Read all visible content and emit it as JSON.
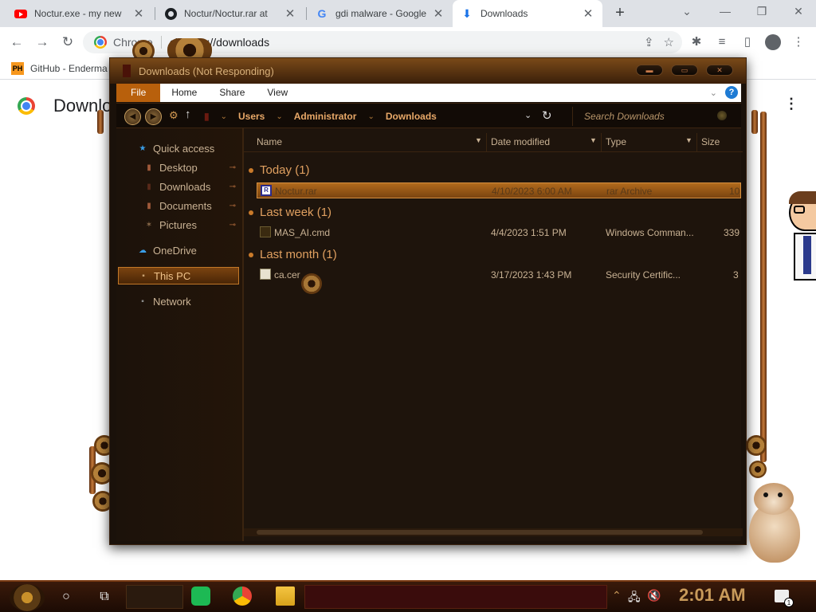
{
  "browser": {
    "tabs": [
      {
        "title": "Noctur.exe - my new",
        "icon": "youtube-icon"
      },
      {
        "title": "Noctur/Noctur.rar at",
        "icon": "github-icon"
      },
      {
        "title": "gdi malware - Google",
        "icon": "google-icon"
      },
      {
        "title": "Downloads",
        "icon": "download-icon"
      }
    ],
    "omnibox_chip": "Chrome",
    "url": "chrome://downloads",
    "bookmark": {
      "badge": "PH",
      "label": "GitHub - Enderma"
    },
    "page_title": "Download"
  },
  "explorer": {
    "title": "Downloads (Not Responding)",
    "ribbon_tabs": [
      "File",
      "Home",
      "Share",
      "View"
    ],
    "breadcrumb": [
      "Users",
      "Administrator",
      "Downloads"
    ],
    "search_placeholder": "Search Downloads",
    "nav": {
      "quick_access": "Quick access",
      "pinned": [
        "Desktop",
        "Downloads",
        "Documents",
        "Pictures"
      ],
      "onedrive": "OneDrive",
      "this_pc": "This PC",
      "network": "Network"
    },
    "columns": [
      "Name",
      "Date modified",
      "Type",
      "Size"
    ],
    "groups": [
      {
        "label": "Today (1)",
        "files": [
          {
            "name": "Noctur.rar",
            "date": "4/10/2023 6:00 AM",
            "type": "rar Archive",
            "size": "10"
          }
        ]
      },
      {
        "label": "Last week (1)",
        "files": [
          {
            "name": "MAS_AI.cmd",
            "date": "4/4/2023 1:51 PM",
            "type": "Windows Comman...",
            "size": "339"
          }
        ]
      },
      {
        "label": "Last month (1)",
        "files": [
          {
            "name": "ca.cer",
            "date": "3/17/2023 1:43 PM",
            "type": "Security Certific...",
            "size": "3"
          }
        ]
      }
    ]
  },
  "taskbar": {
    "clock": "2:01 AM",
    "notification_count": "1"
  }
}
